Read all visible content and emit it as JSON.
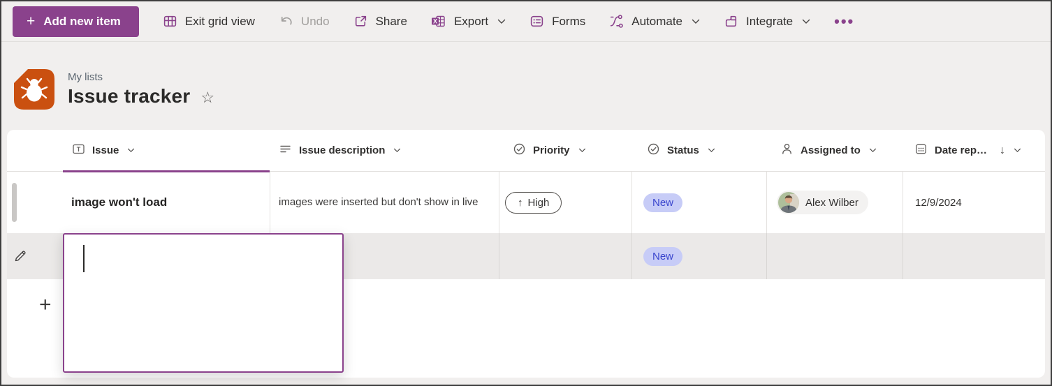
{
  "colors": {
    "accent": "#8a428c",
    "list_icon_bg": "#ca5010",
    "status_badge_bg": "#c7ccf7",
    "status_badge_text": "#3a45cd",
    "toolbar_disabled_text": "#a19f9d",
    "row2_background": "#ebe9e8"
  },
  "glyphs": {
    "plus": "+",
    "add_row_plus": "+",
    "more": "•••",
    "star": "☆",
    "sort_desc": "↓",
    "priority_up": "↑",
    "text_column_t": "T",
    "export_x": "X"
  },
  "toolbar": {
    "add_new_item": "Add new item",
    "exit_grid_view": "Exit grid view",
    "undo": "Undo",
    "share": "Share",
    "export": "Export",
    "forms": "Forms",
    "automate": "Automate",
    "integrate": "Integrate"
  },
  "header": {
    "breadcrumb": "My lists",
    "title": "Issue tracker"
  },
  "columns": [
    {
      "label": "Issue"
    },
    {
      "label": "Issue description"
    },
    {
      "label": "Priority"
    },
    {
      "label": "Status"
    },
    {
      "label": "Assigned to"
    },
    {
      "label": "Date rep…",
      "sort": "↓"
    }
  ],
  "rows": [
    {
      "issue": "image won't load",
      "description": "images were inserted but don't show in live",
      "priority": "High",
      "status": "New",
      "assigned_to": "Alex Wilber",
      "date_reported": "12/9/2024"
    },
    {
      "status": "New"
    }
  ]
}
